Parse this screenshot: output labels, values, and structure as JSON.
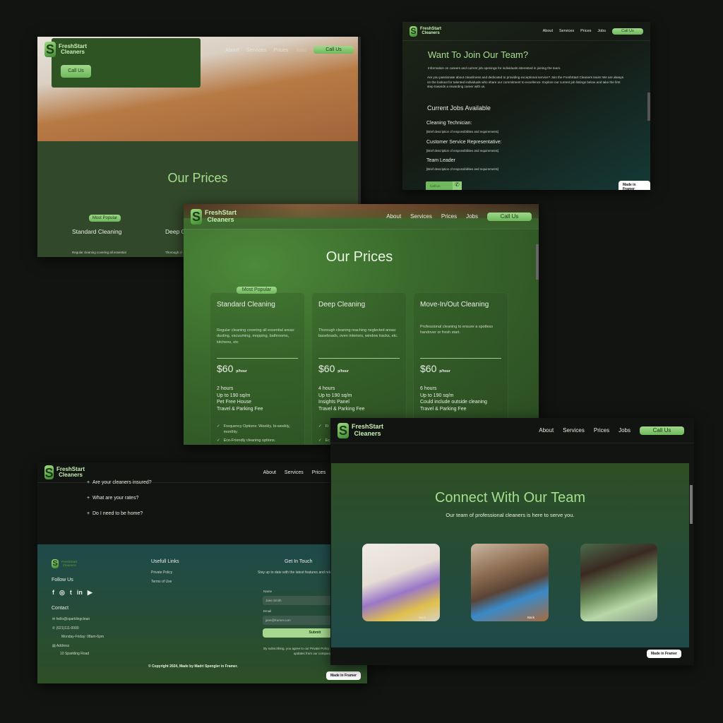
{
  "brand": {
    "line1": "FreshStart",
    "line2": "Cleaners",
    "mark": "S"
  },
  "nav": {
    "about": "About",
    "services": "Services",
    "prices": "Prices",
    "jobs": "Jobs",
    "call": "Call Us"
  },
  "made_in_framer": "Made in Framer",
  "colors": {
    "accent": "#8fd17a",
    "heading": "#a6df8e",
    "dark": "#121411",
    "forest": "#2f4a27",
    "teal": "#1e4a48"
  },
  "hero_panel": {
    "call_button": "Call Us",
    "title": "Our Prices",
    "badge": "Most Popular",
    "card1": "Standard Cleaning",
    "card1_desc": "Regular cleaning covering all essential",
    "card2": "Deep C",
    "card2_desc": "Thorough cl"
  },
  "jobs_panel": {
    "title": "Want To Join Our Team?",
    "intro": "Information on careers and current job openings for individuals interested in joining the team.",
    "body": "Are you passionate about cleanliness and dedicated to providing exceptional service?  Join the FreshStart Cleaners team!  We are always on the lookout for talented individuals who share our commitment to excellence. Explore our current job listings below and take the first step towards a rewarding career with us.",
    "subtitle": "Current Jobs Available",
    "jobs": [
      {
        "title": "Cleaning Technician:",
        "desc": "[Brief description of responsibilities and requirements]"
      },
      {
        "title": "Customer Service Representative:",
        "desc": "[Brief description of responsibilities and requirements]"
      },
      {
        "title": "Team Leader",
        "desc": "[Brief description of responsibilities and requirements]"
      }
    ],
    "call": "Call Us",
    "phone_icon": "phone-icon"
  },
  "prices": {
    "title": "Our Prices",
    "badge": "Most Popular",
    "unit": "p/hour",
    "plans": [
      {
        "name": "Standard Cleaning",
        "desc": "Regular cleaning covering all essential areas: dusting, vacuuming, mopping, bathrooms, kitchens, etc",
        "price": "$60",
        "features": [
          "2 hours",
          "Up to 190 sq/m",
          "Pet Free House",
          "Travel & Parking Fee"
        ],
        "checks": [
          "Frequency Options:  Weekly, bi-weekly, monthly.",
          "Eco-Friendly cleaning options."
        ]
      },
      {
        "name": "Deep Cleaning",
        "desc": "Thorough cleaning reaching neglected areas: baseboads, oven interiors, window tracks, etc.",
        "price": "$60",
        "features": [
          "4 hours",
          "Up to 190 sq/m",
          "Insights Panel",
          "Travel & Parking Fee"
        ],
        "checks": [
          "Fr",
          "Ec"
        ]
      },
      {
        "name": "Move-In/Out Cleaning",
        "desc": "Professional cleaning to ensure a spotless handover or fresh start.",
        "price": "$60",
        "features": [
          "6 hours",
          "Up to 190 sq/m",
          "Could include outside cleaning",
          "Travel & Parking Fee"
        ],
        "checks": []
      }
    ]
  },
  "faq": {
    "items": [
      "Are your cleaners insured?",
      "What are your rates?",
      "Do I need to be home?"
    ]
  },
  "footer": {
    "follow": "Follow Us",
    "social": [
      "facebook-icon",
      "instagram-icon",
      "twitter-icon",
      "linkedin-icon",
      "youtube-icon"
    ],
    "contact": "Contact",
    "email": "hello@sparklingclean",
    "phone": "(021)111-0000",
    "hours": "Monday-Friday: 08am-6pm",
    "address_label": "Address",
    "address": "10 Sparkling Road",
    "links_title": "Usefull Links",
    "links": [
      "Private Policy",
      "Terms of Use"
    ],
    "get_in_touch": "Get In Touch",
    "newsletter": "Stay up to date with the latest features and releases by joining our newsletter.",
    "name_label": "Name",
    "name_placeholder": "Jane Smith",
    "email_label": "Email",
    "email_placeholder": "jane@framer.com",
    "submit": "Submit",
    "disclaimer": "By subscribing, you agree to our Private Policy and consent to receive updates from our company.",
    "copyright": "© Copyright 2024,  Made by Madri Spengler in Framer."
  },
  "team": {
    "title": "Connect With Our Team",
    "subtitle": "Our team of professional cleaners is here to serve you.",
    "photo_caption": "Back"
  }
}
